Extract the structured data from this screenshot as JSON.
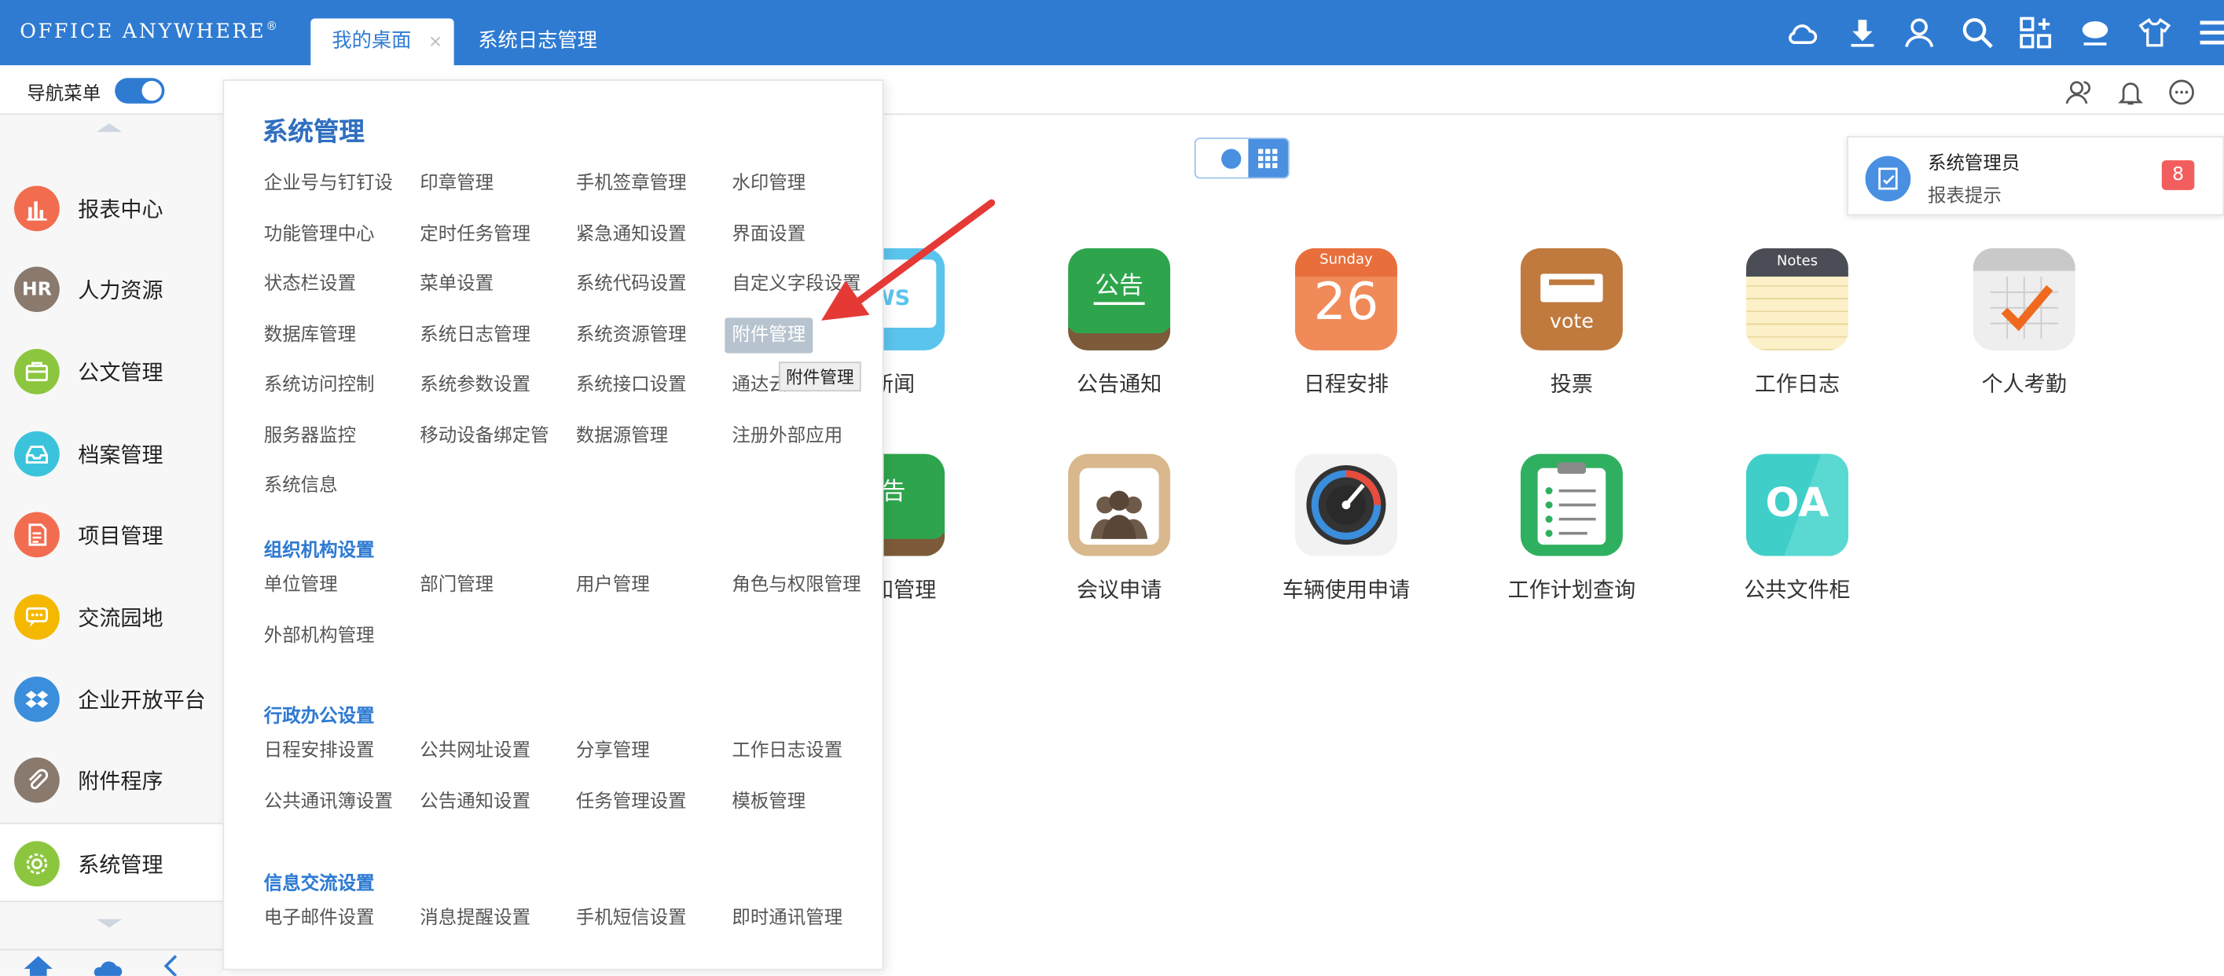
{
  "header": {
    "logo": "OFFICE ANYWHERE",
    "logo_mark": "®",
    "tabs": [
      {
        "label": "我的桌面",
        "close": "×"
      },
      {
        "label": "系统日志管理"
      }
    ]
  },
  "subbar": {
    "nav_label": "导航菜单"
  },
  "sidebar": {
    "items": [
      {
        "label": "报表中心",
        "color": "#f26d4f",
        "icon": "chart-icon"
      },
      {
        "label": "人力资源",
        "color": "#8a7a6e",
        "icon": "hr-icon",
        "glyph": "HR"
      },
      {
        "label": "公文管理",
        "color": "#8cc63e",
        "icon": "briefcase-icon"
      },
      {
        "label": "档案管理",
        "color": "#3cc3dc",
        "icon": "tray-icon"
      },
      {
        "label": "项目管理",
        "color": "#f26d4f",
        "icon": "document-icon"
      },
      {
        "label": "交流园地",
        "color": "#f5b800",
        "icon": "chat-icon"
      },
      {
        "label": "企业开放平台",
        "color": "#3a8edb",
        "icon": "dropbox-icon"
      },
      {
        "label": "附件程序",
        "color": "#8a7a6e",
        "icon": "paperclip-icon"
      },
      {
        "label": "系统管理",
        "color": "#8cc63e",
        "icon": "gear-icon"
      }
    ]
  },
  "menu": {
    "title": "系统管理",
    "tooltip": "附件管理",
    "sections": [
      {
        "title": "",
        "items": [
          "企业号与钉钉设",
          "印章管理",
          "手机签章管理",
          "水印管理",
          "功能管理中心",
          "定时任务管理",
          "紧急通知设置",
          "界面设置",
          "状态栏设置",
          "菜单设置",
          "系统代码设置",
          "自定义字段设置",
          "数据库管理",
          "系统日志管理",
          "系统资源管理",
          "附件管理",
          "系统访问控制",
          "系统参数设置",
          "系统接口设置",
          "通达云",
          "服务器监控",
          "移动设备绑定管",
          "数据源管理",
          "注册外部应用",
          "系统信息"
        ]
      },
      {
        "title": "组织机构设置",
        "items": [
          "单位管理",
          "部门管理",
          "用户管理",
          "角色与权限管理",
          "外部机构管理"
        ]
      },
      {
        "title": "行政办公设置",
        "items": [
          "日程安排设置",
          "公共网址设置",
          "分享管理",
          "工作日志设置",
          "公共通讯簿设置",
          "公告通知设置",
          "任务管理设置",
          "模板管理"
        ]
      },
      {
        "title": "信息交流设置",
        "items": [
          "电子邮件设置",
          "消息提醒设置",
          "手机短信设置",
          "即时通讯管理"
        ]
      }
    ]
  },
  "apps": {
    "row1": [
      {
        "label": "新闻",
        "icon": "news-icon",
        "icon_text": "EWS"
      },
      {
        "label": "公告通知",
        "icon": "announcement-icon",
        "icon_text": "公告"
      },
      {
        "label": "日程安排",
        "icon": "calendar-icon",
        "day_name": "Sunday",
        "day_number": "26"
      },
      {
        "label": "投票",
        "icon": "vote-icon",
        "icon_text": "vote"
      },
      {
        "label": "工作日志",
        "icon": "notes-icon",
        "icon_text": "Notes"
      },
      {
        "label": "个人考勤",
        "icon": "attendance-icon"
      }
    ],
    "row2": [
      {
        "label": "通知管理",
        "icon": "announcement-icon",
        "icon_text": "告"
      },
      {
        "label": "会议申请",
        "icon": "meeting-icon"
      },
      {
        "label": "车辆使用申请",
        "icon": "speedometer-icon"
      },
      {
        "label": "工作计划查询",
        "icon": "checklist-icon"
      },
      {
        "label": "公共文件柜",
        "icon": "oa-icon",
        "icon_text": "OA"
      }
    ]
  },
  "notification": {
    "title": "系统管理员",
    "subtitle": "报表提示",
    "count": "8"
  }
}
